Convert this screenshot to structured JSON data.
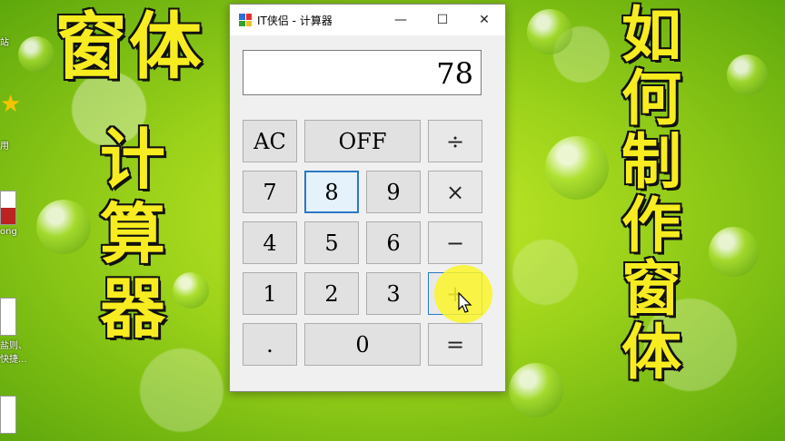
{
  "desktop": {
    "icon_labels": [
      "站",
      "用",
      "ong",
      "盐则、快捷..."
    ]
  },
  "overlay": {
    "left_title": [
      "窗",
      "体"
    ],
    "left_column": [
      "计",
      "算",
      "器"
    ],
    "right_column": [
      "如",
      "何",
      "制",
      "作",
      "窗",
      "体"
    ]
  },
  "window": {
    "title": "IT侠侣 - 计算器",
    "controls": {
      "minimize": "—",
      "maximize": "☐",
      "close": "✕"
    }
  },
  "calculator": {
    "display_value": "78",
    "buttons": {
      "ac": "AC",
      "off": "OFF",
      "divide": "÷",
      "seven": "7",
      "eight": "8",
      "nine": "9",
      "multiply": "×",
      "four": "4",
      "five": "5",
      "six": "6",
      "minus": "−",
      "one": "1",
      "two": "2",
      "three": "3",
      "plus": "+",
      "dot": ".",
      "zero": "0",
      "equals": "="
    }
  },
  "colors": {
    "overlay_text": "#f7ec1f",
    "focus_border": "#2b78c5",
    "cursor_halo": "#faf528"
  }
}
